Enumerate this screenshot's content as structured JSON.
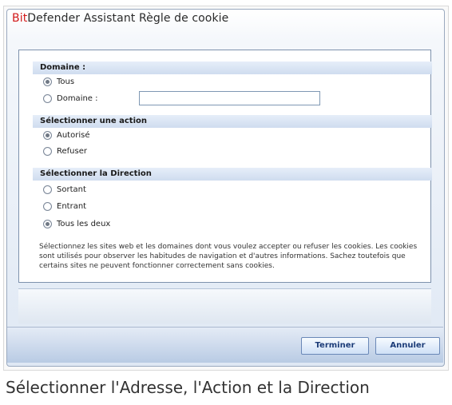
{
  "window": {
    "title_brand": "Bit",
    "title_rest": "Defender Assistant Règle de cookie"
  },
  "sections": {
    "domain_header": "Domaine :",
    "action_header": "Sélectionner une action",
    "direction_header": "Sélectionner la Direction"
  },
  "domain": {
    "options": [
      "Tous",
      "Domaine :"
    ],
    "selected": "Tous",
    "input_value": "",
    "input_placeholder": ""
  },
  "action": {
    "options": [
      "Autorisé",
      "Refuser"
    ],
    "selected": "Autorisé"
  },
  "direction": {
    "options": [
      "Sortant",
      "Entrant",
      "Tous les deux"
    ],
    "selected": "Tous les deux"
  },
  "description": "Sélectionnez les sites web et les domaines dont vous voulez accepter ou refuser les cookies. Les cookies sont utilisés pour observer les habitudes de navigation et d'autres informations. Sachez toutefois que certains sites ne peuvent fonctionner correctement sans cookies.",
  "buttons": {
    "finish": "Terminer",
    "cancel": "Annuler"
  },
  "caption": "Sélectionner l'Adresse, l'Action et la Direction"
}
